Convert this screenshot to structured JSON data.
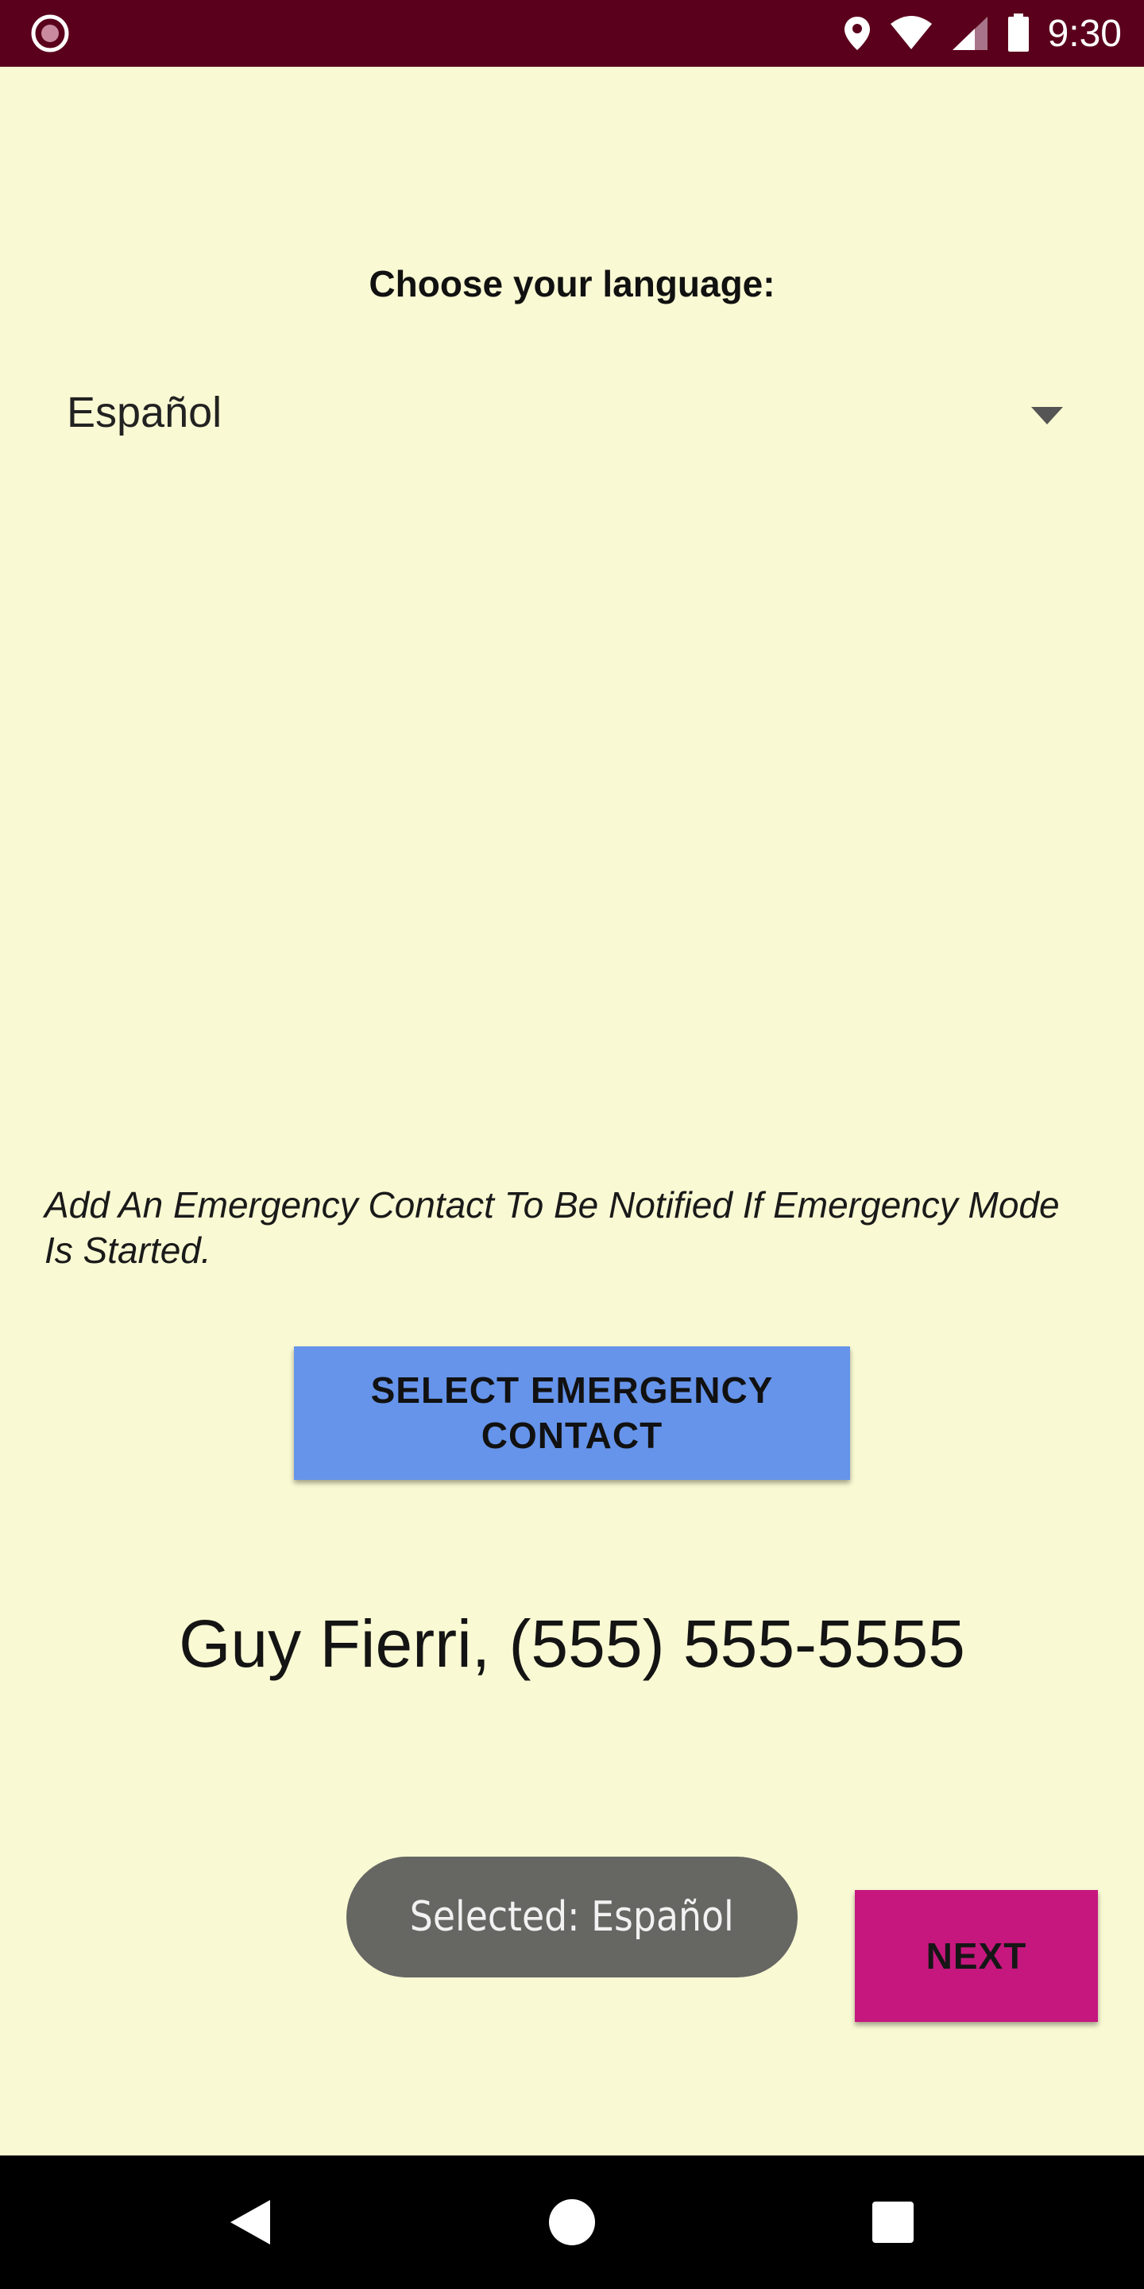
{
  "status_bar": {
    "time": "9:30",
    "icons": [
      "app-notification-icon",
      "location-icon",
      "wifi-icon",
      "cell-signal-icon",
      "battery-icon"
    ],
    "background": "#5a001c"
  },
  "language": {
    "heading": "Choose your language:",
    "selected": "Español"
  },
  "emergency": {
    "note": "Add An Emergency Contact To Be Notified If Emergency Mode Is Started.",
    "button_label": "SELECT EMERGENCY CONTACT",
    "button_color": "#6694ea",
    "contact": "Guy Fierri, (555) 555-5555"
  },
  "toast": {
    "text": "Selected: Español"
  },
  "next_button": {
    "label": "NEXT",
    "color": "#c6177f"
  },
  "nav_bar": {
    "buttons": [
      "back-icon",
      "home-icon",
      "recents-icon"
    ]
  },
  "colors": {
    "background": "#f9f9d3"
  }
}
